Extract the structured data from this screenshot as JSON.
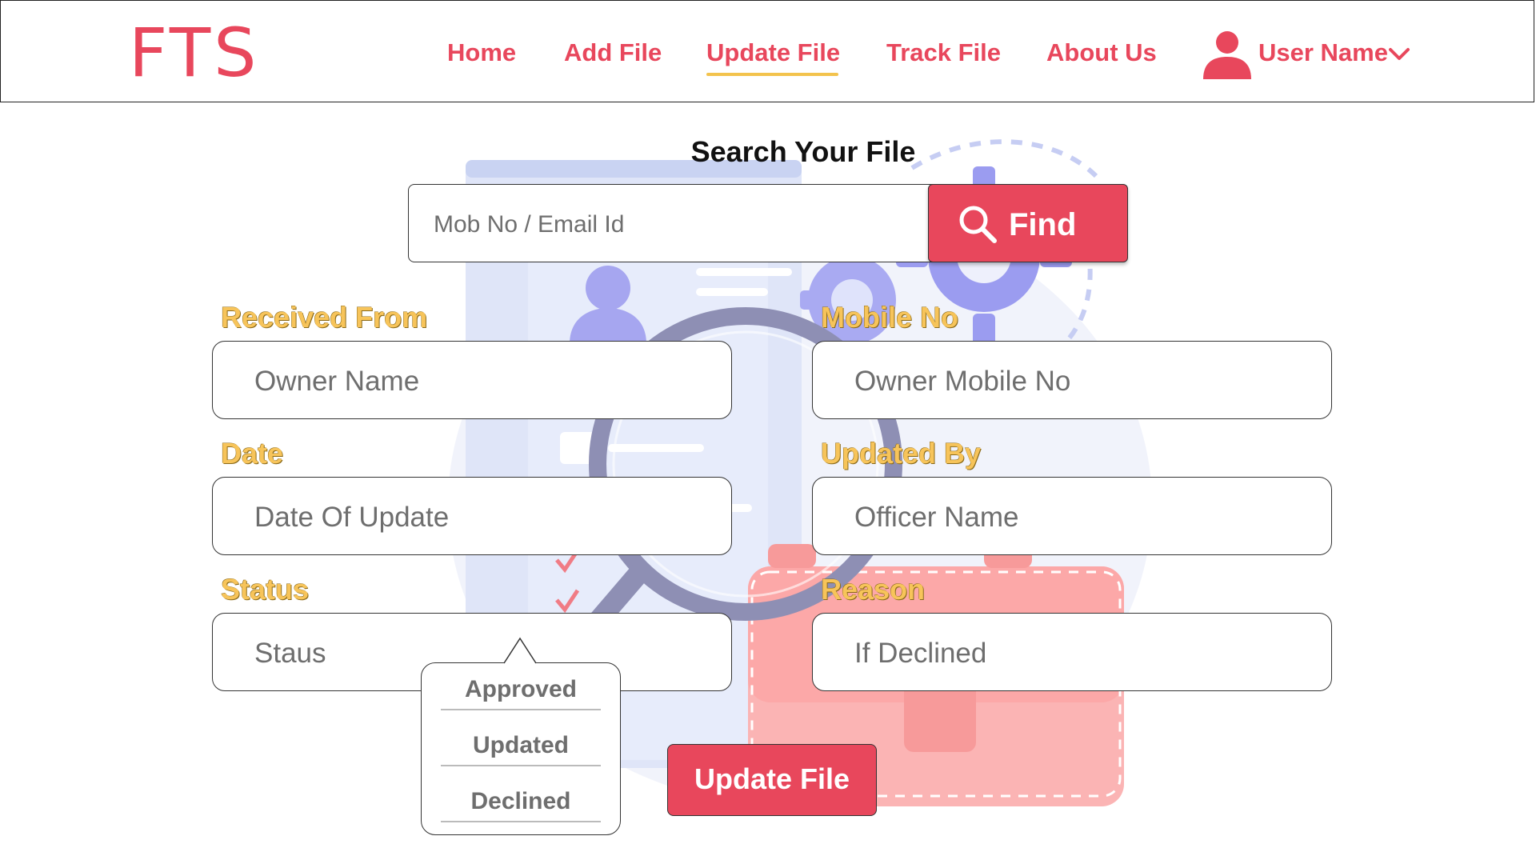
{
  "header": {
    "logo": "FTS",
    "nav": [
      {
        "label": "Home"
      },
      {
        "label": "Add File"
      },
      {
        "label": "Update File",
        "active": true
      },
      {
        "label": "Track File"
      },
      {
        "label": "About Us"
      }
    ],
    "user_name": "User Name"
  },
  "search": {
    "title": "Search Your File",
    "placeholder": "Mob No / Email Id",
    "button_label": "Find"
  },
  "form": {
    "received_from": {
      "label": "Received From",
      "placeholder": "Owner Name"
    },
    "mobile_no": {
      "label": "Mobile No",
      "placeholder": "Owner Mobile No"
    },
    "date": {
      "label": "Date",
      "placeholder": "Date Of Update"
    },
    "updated_by": {
      "label": "Updated By",
      "placeholder": "Officer Name"
    },
    "status": {
      "label": "Status",
      "placeholder": "Staus",
      "options": [
        "Approved",
        "Updated",
        "Declined"
      ]
    },
    "reason": {
      "label": "Reason",
      "placeholder": "If Declined"
    },
    "submit_label": "Update File"
  },
  "colors": {
    "brand": "#e8475c",
    "label": "#f7c45a",
    "active_underline": "#f3c34d"
  },
  "icons": {
    "user": "user-icon",
    "chevron": "chevron-down-icon",
    "search": "search-icon"
  }
}
